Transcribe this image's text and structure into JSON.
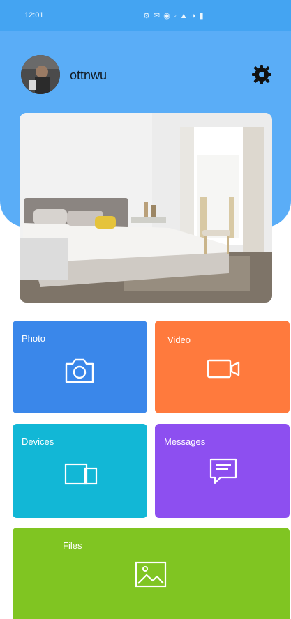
{
  "status_bar": {
    "time": "12:01",
    "icons_text": "⚙ ✉ ◉ ◦ ▲ ◑ ▮"
  },
  "profile": {
    "username": "ottnwu"
  },
  "tiles": {
    "photo": {
      "label": "Photo",
      "icon": "camera-icon"
    },
    "video": {
      "label": "Video",
      "icon": "video-camera-icon"
    },
    "devices": {
      "label": "Devices",
      "icon": "devices-icon"
    },
    "messages": {
      "label": "Messages",
      "icon": "message-icon"
    },
    "files": {
      "label": "Files",
      "icon": "image-file-icon"
    }
  },
  "colors": {
    "header": "#5aadf7",
    "status_bar": "#44a4f2",
    "photo": "#3a87ea",
    "video": "#ff7a3d",
    "devices": "#12b7d6",
    "messages": "#8d4ff0",
    "files": "#80c522"
  }
}
